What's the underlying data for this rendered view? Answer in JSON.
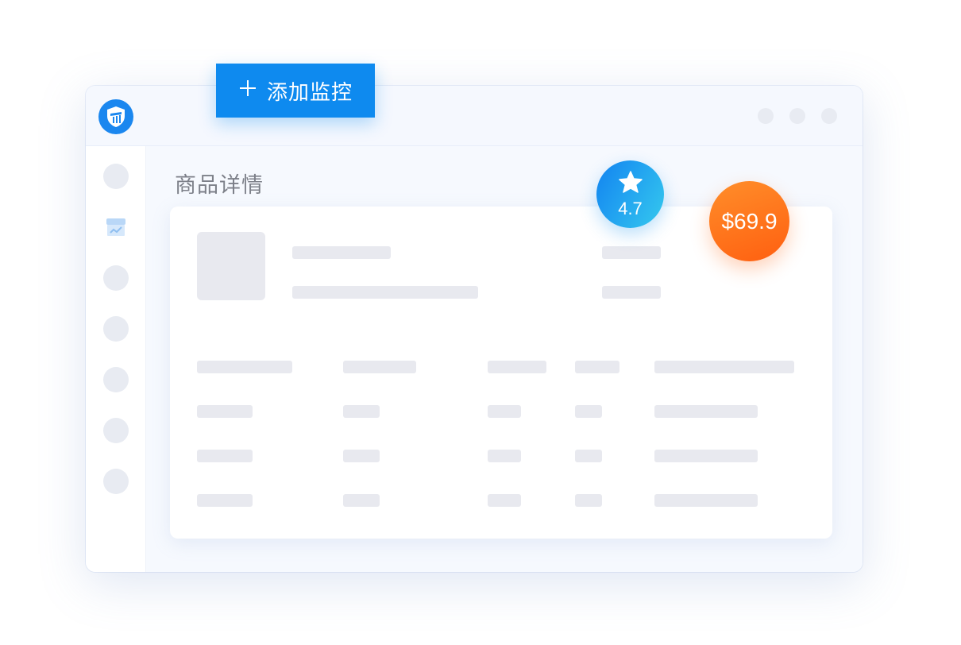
{
  "toolbar": {
    "add_label": "添加监控",
    "add_icon": "plus-icon"
  },
  "app": {
    "logo_icon": "shield-logo-icon",
    "window_controls": [
      "window-dot",
      "window-dot",
      "window-dot"
    ]
  },
  "page": {
    "title": "商品详情"
  },
  "sidebar": {
    "active_icon": "store-chart-icon"
  },
  "badges": {
    "rating": {
      "icon": "star-icon",
      "value": "4.7"
    },
    "price": "$69.9"
  },
  "colors": {
    "accent": "#0e8aef",
    "rating_gradient": [
      "#1283f1",
      "#35c9ee"
    ],
    "price_gradient": [
      "#ff8e2a",
      "#ff5f10"
    ],
    "placeholder": "#e8e9ef"
  }
}
